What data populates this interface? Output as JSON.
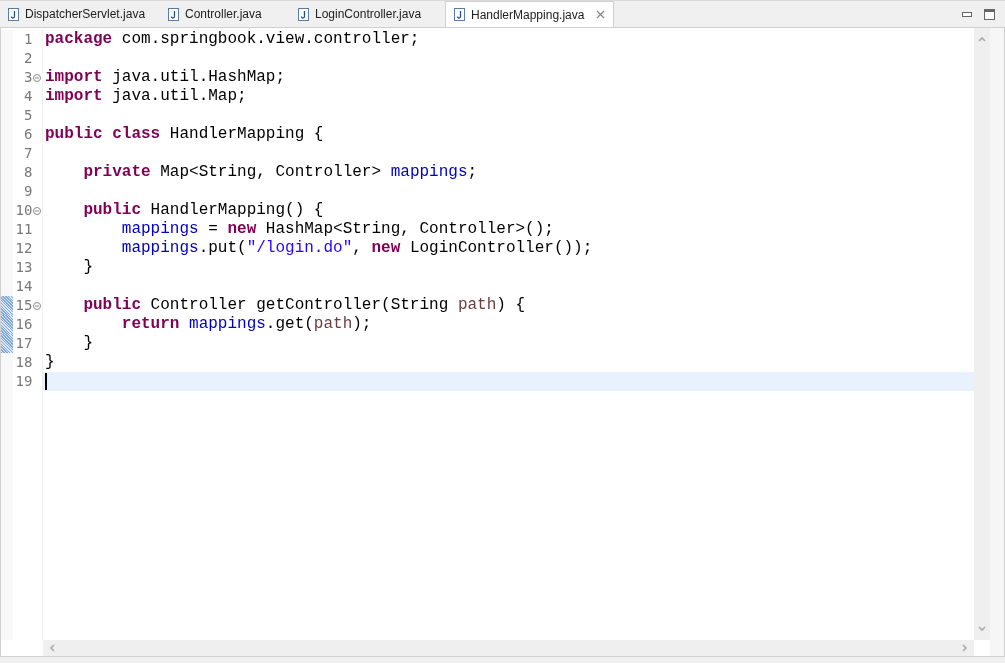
{
  "tabs": [
    {
      "label": "DispatcherServlet.java",
      "selected": false
    },
    {
      "label": "Controller.java",
      "selected": false
    },
    {
      "label": "LoginController.java",
      "selected": false
    },
    {
      "label": "HandlerMapping.java",
      "selected": true
    }
  ],
  "lines": [
    {
      "number": "1",
      "fold": false,
      "changed": false,
      "current": false,
      "tokens": [
        {
          "kind": "keyword",
          "text": "package"
        },
        {
          "kind": "plain",
          "text": " com.springbook.view.controller;"
        }
      ]
    },
    {
      "number": "2",
      "fold": false,
      "changed": false,
      "current": false
    },
    {
      "number": "3",
      "fold": true,
      "changed": false,
      "current": false,
      "tokens": [
        {
          "kind": "keyword",
          "text": "import"
        },
        {
          "kind": "plain",
          "text": " java.util.HashMap;"
        }
      ]
    },
    {
      "number": "4",
      "fold": false,
      "changed": false,
      "current": false,
      "tokens": [
        {
          "kind": "keyword",
          "text": "import"
        },
        {
          "kind": "plain",
          "text": " java.util.Map;"
        }
      ]
    },
    {
      "number": "5",
      "fold": false,
      "changed": false,
      "current": false
    },
    {
      "number": "6",
      "fold": false,
      "changed": false,
      "current": false,
      "tokens": [
        {
          "kind": "keyword",
          "text": "public class"
        },
        {
          "kind": "plain",
          "text": " HandlerMapping {"
        }
      ]
    },
    {
      "number": "7",
      "fold": false,
      "changed": false,
      "current": false
    },
    {
      "number": "8",
      "fold": false,
      "changed": false,
      "current": false,
      "tokens": [
        {
          "kind": "keyword",
          "text": "    private"
        },
        {
          "kind": "plain",
          "text": " Map<String, Controller> "
        },
        {
          "kind": "field",
          "text": "mappings"
        },
        {
          "kind": "plain",
          "text": ";"
        }
      ]
    },
    {
      "number": "9",
      "fold": false,
      "changed": false,
      "current": false
    },
    {
      "number": "10",
      "fold": true,
      "changed": false,
      "current": false,
      "tokens": [
        {
          "kind": "keyword",
          "text": "    public"
        },
        {
          "kind": "plain",
          "text": " HandlerMapping() {"
        }
      ]
    },
    {
      "number": "11",
      "fold": false,
      "changed": false,
      "current": false,
      "tokens": [
        {
          "kind": "field",
          "text": "        mappings"
        },
        {
          "kind": "plain",
          "text": " = "
        },
        {
          "kind": "keyword",
          "text": "new"
        },
        {
          "kind": "plain",
          "text": " HashMap<String, Controller>();"
        }
      ]
    },
    {
      "number": "12",
      "fold": false,
      "changed": false,
      "current": false,
      "tokens": [
        {
          "kind": "field",
          "text": "        mappings"
        },
        {
          "kind": "plain",
          "text": ".put("
        },
        {
          "kind": "string",
          "text": "\"/login.do\""
        },
        {
          "kind": "plain",
          "text": ", "
        },
        {
          "kind": "keyword",
          "text": "new"
        },
        {
          "kind": "plain",
          "text": " LoginController());"
        }
      ]
    },
    {
      "number": "13",
      "fold": false,
      "changed": false,
      "current": false,
      "tokens": [
        {
          "kind": "plain",
          "text": "    }"
        }
      ]
    },
    {
      "number": "14",
      "fold": false,
      "changed": false,
      "current": false
    },
    {
      "number": "15",
      "fold": true,
      "changed": true,
      "current": false,
      "tokens": [
        {
          "kind": "keyword",
          "text": "    public"
        },
        {
          "kind": "plain",
          "text": " Controller getController(String "
        },
        {
          "kind": "param",
          "text": "path"
        },
        {
          "kind": "plain",
          "text": ") {"
        }
      ]
    },
    {
      "number": "16",
      "fold": false,
      "changed": true,
      "current": false,
      "tokens": [
        {
          "kind": "keyword",
          "text": "        return "
        },
        {
          "kind": "field",
          "text": "mappings"
        },
        {
          "kind": "plain",
          "text": ".get("
        },
        {
          "kind": "param",
          "text": "path"
        },
        {
          "kind": "plain",
          "text": ");"
        }
      ]
    },
    {
      "number": "17",
      "fold": false,
      "changed": true,
      "current": false,
      "tokens": [
        {
          "kind": "plain",
          "text": "    }"
        }
      ]
    },
    {
      "number": "18",
      "fold": false,
      "changed": false,
      "current": false,
      "tokens": [
        {
          "kind": "plain",
          "text": "}"
        }
      ]
    },
    {
      "number": "19",
      "fold": false,
      "changed": false,
      "current": true
    }
  ]
}
